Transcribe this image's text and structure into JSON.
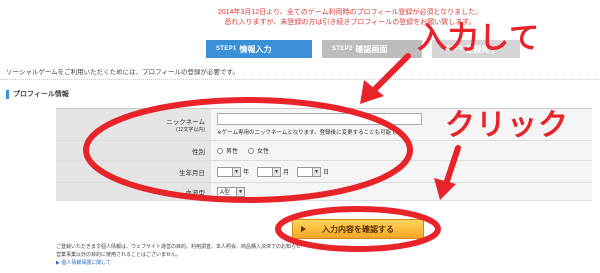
{
  "notice": {
    "line1": "2014年3月12日より、全てのゲーム利用時のプロフィール登録が必須となりました。",
    "line2": "恐れ入りますが、未登録の方は引き続きプロフィールの登録をお願い致します。"
  },
  "steps": [
    {
      "num": "STEP1",
      "label": "情報入力"
    },
    {
      "num": "STEP2",
      "label": "確認画面"
    },
    {
      "num": "STEP3",
      "label": "登録完了"
    }
  ],
  "intro": "ソーシャルゲームをご利用いただくためには、プロフィールの登録が必要です。",
  "section_title": "プロフィール情報",
  "form": {
    "nickname_label": "ニックネーム",
    "nickname_sub": "(12文字以内)",
    "nickname_value": "",
    "nickname_hint": "※ゲーム専用のニックネームとなります。登録後に変更することも可能です。",
    "gender_label": "性別",
    "gender_options": [
      "男性",
      "女性"
    ],
    "birth_label": "生年月日",
    "birth_units": [
      "年",
      "月",
      "日"
    ],
    "blood_label": "血液型",
    "blood_value": "A型"
  },
  "confirm_button": "入力内容を確認する",
  "footer": {
    "text1": "ご登録いただきます個人情報は、ウェブサイト運営の目的、利用調査、本人照会、商品購入決済でのお知らせ",
    "text2": "営業事業以外の目的に使用されることはございません。",
    "link": "▶ 個人情報保護に関して"
  },
  "annotations": {
    "input": "入力して",
    "click": "クリック",
    "color": "#e8232a"
  }
}
